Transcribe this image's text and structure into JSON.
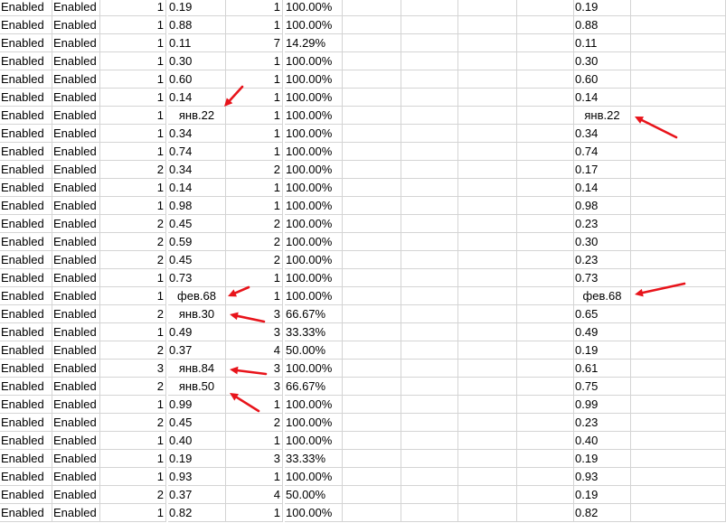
{
  "sheet": {
    "rows": [
      {
        "a": "Enabled",
        "b": "Enabled",
        "c": "1",
        "d": "0.19",
        "d_center": false,
        "f": "1",
        "g": "100.00%",
        "k": "0.19",
        "k_center": false
      },
      {
        "a": "Enabled",
        "b": "Enabled",
        "c": "1",
        "d": "0.88",
        "d_center": false,
        "f": "1",
        "g": "100.00%",
        "k": "0.88",
        "k_center": false
      },
      {
        "a": "Enabled",
        "b": "Enabled",
        "c": "1",
        "d": "0.11",
        "d_center": false,
        "f": "7",
        "g": "14.29%",
        "k": "0.11",
        "k_center": false
      },
      {
        "a": "Enabled",
        "b": "Enabled",
        "c": "1",
        "d": "0.30",
        "d_center": false,
        "f": "1",
        "g": "100.00%",
        "k": "0.30",
        "k_center": false
      },
      {
        "a": "Enabled",
        "b": "Enabled",
        "c": "1",
        "d": "0.60",
        "d_center": false,
        "f": "1",
        "g": "100.00%",
        "k": "0.60",
        "k_center": false
      },
      {
        "a": "Enabled",
        "b": "Enabled",
        "c": "1",
        "d": "0.14",
        "d_center": false,
        "f": "1",
        "g": "100.00%",
        "k": "0.14",
        "k_center": false
      },
      {
        "a": "Enabled",
        "b": "Enabled",
        "c": "1",
        "d": "янв.22",
        "d_center": true,
        "f": "1",
        "g": "100.00%",
        "k": "янв.22",
        "k_center": true
      },
      {
        "a": "Enabled",
        "b": "Enabled",
        "c": "1",
        "d": "0.34",
        "d_center": false,
        "f": "1",
        "g": "100.00%",
        "k": "0.34",
        "k_center": false
      },
      {
        "a": "Enabled",
        "b": "Enabled",
        "c": "1",
        "d": "0.74",
        "d_center": false,
        "f": "1",
        "g": "100.00%",
        "k": "0.74",
        "k_center": false
      },
      {
        "a": "Enabled",
        "b": "Enabled",
        "c": "2",
        "d": "0.34",
        "d_center": false,
        "f": "2",
        "g": "100.00%",
        "k": "0.17",
        "k_center": false
      },
      {
        "a": "Enabled",
        "b": "Enabled",
        "c": "1",
        "d": "0.14",
        "d_center": false,
        "f": "1",
        "g": "100.00%",
        "k": "0.14",
        "k_center": false
      },
      {
        "a": "Enabled",
        "b": "Enabled",
        "c": "1",
        "d": "0.98",
        "d_center": false,
        "f": "1",
        "g": "100.00%",
        "k": "0.98",
        "k_center": false
      },
      {
        "a": "Enabled",
        "b": "Enabled",
        "c": "2",
        "d": "0.45",
        "d_center": false,
        "f": "2",
        "g": "100.00%",
        "k": "0.23",
        "k_center": false
      },
      {
        "a": "Enabled",
        "b": "Enabled",
        "c": "2",
        "d": "0.59",
        "d_center": false,
        "f": "2",
        "g": "100.00%",
        "k": "0.30",
        "k_center": false
      },
      {
        "a": "Enabled",
        "b": "Enabled",
        "c": "2",
        "d": "0.45",
        "d_center": false,
        "f": "2",
        "g": "100.00%",
        "k": "0.23",
        "k_center": false
      },
      {
        "a": "Enabled",
        "b": "Enabled",
        "c": "1",
        "d": "0.73",
        "d_center": false,
        "f": "1",
        "g": "100.00%",
        "k": "0.73",
        "k_center": false
      },
      {
        "a": "Enabled",
        "b": "Enabled",
        "c": "1",
        "d": "фев.68",
        "d_center": true,
        "f": "1",
        "g": "100.00%",
        "k": "фев.68",
        "k_center": true
      },
      {
        "a": "Enabled",
        "b": "Enabled",
        "c": "2",
        "d": "янв.30",
        "d_center": true,
        "f": "3",
        "g": "66.67%",
        "k": "0.65",
        "k_center": false
      },
      {
        "a": "Enabled",
        "b": "Enabled",
        "c": "1",
        "d": "0.49",
        "d_center": false,
        "f": "3",
        "g": "33.33%",
        "k": "0.49",
        "k_center": false
      },
      {
        "a": "Enabled",
        "b": "Enabled",
        "c": "2",
        "d": "0.37",
        "d_center": false,
        "f": "4",
        "g": "50.00%",
        "k": "0.19",
        "k_center": false
      },
      {
        "a": "Enabled",
        "b": "Enabled",
        "c": "3",
        "d": "янв.84",
        "d_center": true,
        "f": "3",
        "g": "100.00%",
        "k": "0.61",
        "k_center": false
      },
      {
        "a": "Enabled",
        "b": "Enabled",
        "c": "2",
        "d": "янв.50",
        "d_center": true,
        "f": "3",
        "g": "66.67%",
        "k": "0.75",
        "k_center": false
      },
      {
        "a": "Enabled",
        "b": "Enabled",
        "c": "1",
        "d": "0.99",
        "d_center": false,
        "f": "1",
        "g": "100.00%",
        "k": "0.99",
        "k_center": false
      },
      {
        "a": "Enabled",
        "b": "Enabled",
        "c": "2",
        "d": "0.45",
        "d_center": false,
        "f": "2",
        "g": "100.00%",
        "k": "0.23",
        "k_center": false
      },
      {
        "a": "Enabled",
        "b": "Enabled",
        "c": "1",
        "d": "0.40",
        "d_center": false,
        "f": "1",
        "g": "100.00%",
        "k": "0.40",
        "k_center": false
      },
      {
        "a": "Enabled",
        "b": "Enabled",
        "c": "1",
        "d": "0.19",
        "d_center": false,
        "f": "3",
        "g": "33.33%",
        "k": "0.19",
        "k_center": false
      },
      {
        "a": "Enabled",
        "b": "Enabled",
        "c": "1",
        "d": "0.93",
        "d_center": false,
        "f": "1",
        "g": "100.00%",
        "k": "0.93",
        "k_center": false
      },
      {
        "a": "Enabled",
        "b": "Enabled",
        "c": "2",
        "d": "0.37",
        "d_center": false,
        "f": "4",
        "g": "50.00%",
        "k": "0.19",
        "k_center": false
      },
      {
        "a": "Enabled",
        "b": "Enabled",
        "c": "1",
        "d": "0.82",
        "d_center": false,
        "f": "1",
        "g": "100.00%",
        "k": "0.82",
        "k_center": false
      }
    ]
  },
  "colors": {
    "grid": "#d4d4d4",
    "annotation_arrow": "#e8141b"
  },
  "annotations": {
    "icon": "red-arrow-icon",
    "count": 8
  }
}
